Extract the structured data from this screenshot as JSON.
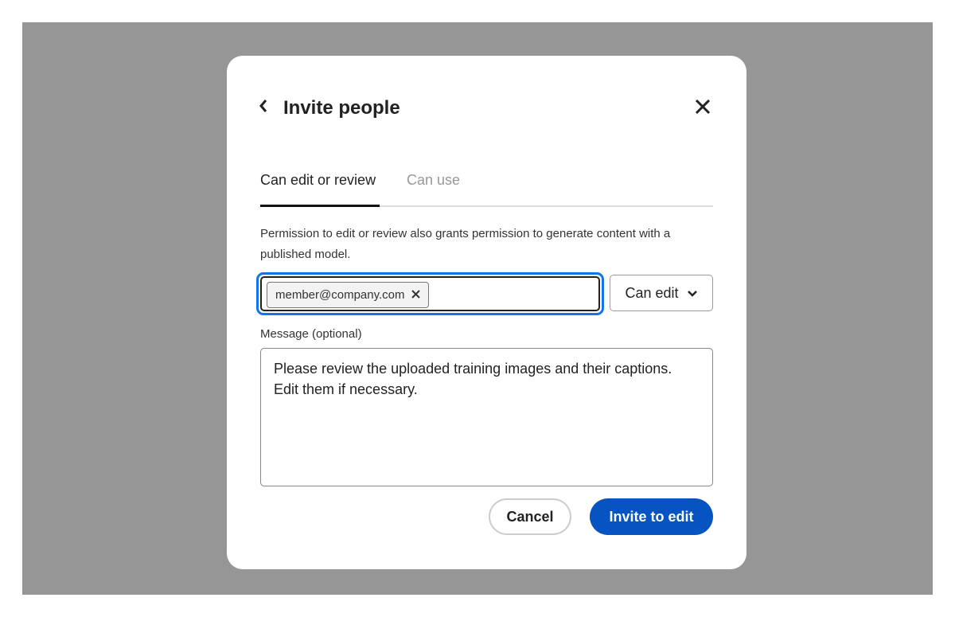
{
  "dialog": {
    "title": "Invite people",
    "back_icon": "‹",
    "close_icon": "✕",
    "tabs": [
      {
        "label": "Can edit or review",
        "selected": true
      },
      {
        "label": "Can use",
        "selected": false
      }
    ],
    "description": "Permission to edit or review also grants permission to generate content with a published model.",
    "recipients": [
      {
        "email": "member@company.com"
      }
    ],
    "chip_remove_icon": "×",
    "permission": {
      "selected": "Can edit",
      "chevron": "⌄"
    },
    "message_label": "Message (optional)",
    "message_value": "Please review the uploaded training images and their captions. Edit them if necessary.",
    "cancel_label": "Cancel",
    "submit_label": "Invite to edit"
  },
  "colors": {
    "accent": "#0654c2",
    "focus_ring": "#1473e6",
    "backdrop": "#969696"
  }
}
